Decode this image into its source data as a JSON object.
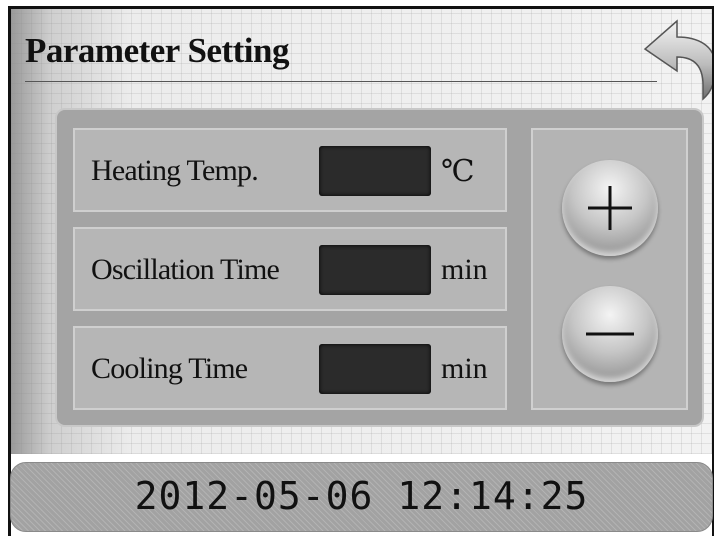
{
  "header": {
    "title": "Parameter Setting",
    "back_icon": "back-arrow-icon"
  },
  "parameters": [
    {
      "label": "Heating Temp.",
      "value": "",
      "unit": "℃"
    },
    {
      "label": "Oscillation Time",
      "value": "",
      "unit": "min"
    },
    {
      "label": "Cooling Time",
      "value": "",
      "unit": "min"
    }
  ],
  "controls": {
    "increase_icon": "plus-icon",
    "decrease_icon": "minus-icon"
  },
  "status": {
    "datetime": "2012-05-06 12:14:25"
  },
  "colors": {
    "value_box": "#2b2b2b",
    "content_box": "#a4a4a4",
    "status_bar": "#a2a2a2"
  }
}
